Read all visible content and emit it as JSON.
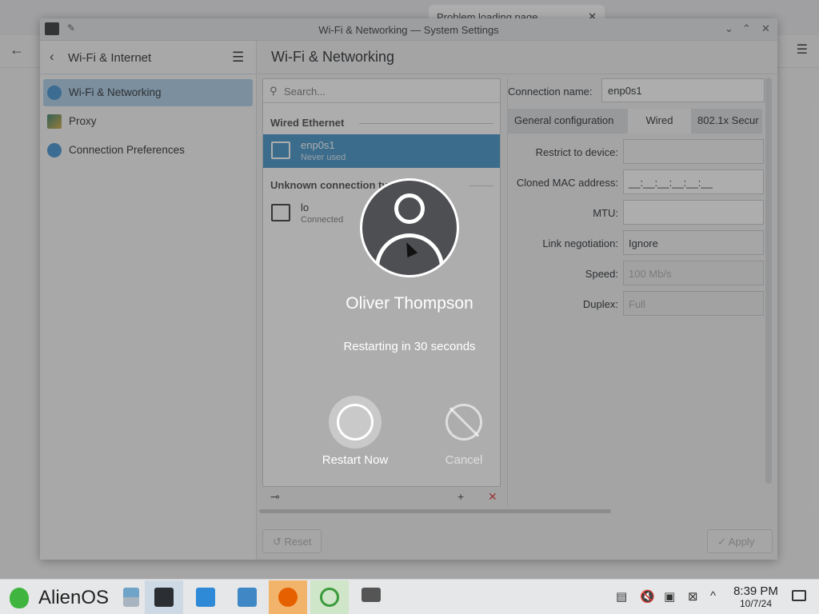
{
  "background_browser": {
    "tab_title": "Problem loading page",
    "back_icon": "arrow-left-icon",
    "menu_icon": "hamburger-icon"
  },
  "window": {
    "title": "Wi-Fi & Networking — System Settings"
  },
  "sidebar": {
    "back_label": "Wi-Fi & Internet",
    "items": [
      {
        "label": "Wi-Fi & Networking",
        "icon": "globe-icon",
        "active": true
      },
      {
        "label": "Proxy",
        "icon": "proxy-icon",
        "active": false
      },
      {
        "label": "Connection Preferences",
        "icon": "globe-icon",
        "active": false
      }
    ]
  },
  "main": {
    "title": "Wi-Fi & Networking",
    "search_placeholder": "Search...",
    "groups": [
      {
        "label": "Wired Ethernet",
        "connections": [
          {
            "name": "enp0s1",
            "status": "Never used",
            "selected": true
          }
        ]
      },
      {
        "label": "Unknown connection type",
        "connections": [
          {
            "name": "lo",
            "status": "Connected",
            "selected": false
          }
        ]
      }
    ],
    "connection_name_label": "Connection name:",
    "connection_name_value": "enp0s1",
    "tabs": [
      "General configuration",
      "Wired",
      "802.1x Secur"
    ],
    "active_tab": "Wired",
    "form": {
      "restrict_label": "Restrict to device:",
      "restrict_value": "",
      "mac_label": "Cloned MAC address:",
      "mac_value": "__:__:__:__:__:__",
      "mtu_label": "MTU:",
      "mtu_value": "",
      "link_label": "Link negotiation:",
      "link_value": "Ignore",
      "speed_label": "Speed:",
      "speed_value": "100 Mb/s",
      "duplex_label": "Duplex:",
      "duplex_value": "Full"
    },
    "reset_label": "Reset",
    "apply_label": "Apply"
  },
  "logout_dialog": {
    "user_name": "Oliver Thompson",
    "message": "Restarting in 30 seconds",
    "restart_label": "Restart Now",
    "cancel_label": "Cancel"
  },
  "taskbar": {
    "os_name": "AlienOS",
    "time": "8:39 PM",
    "date": "10/7/24"
  }
}
